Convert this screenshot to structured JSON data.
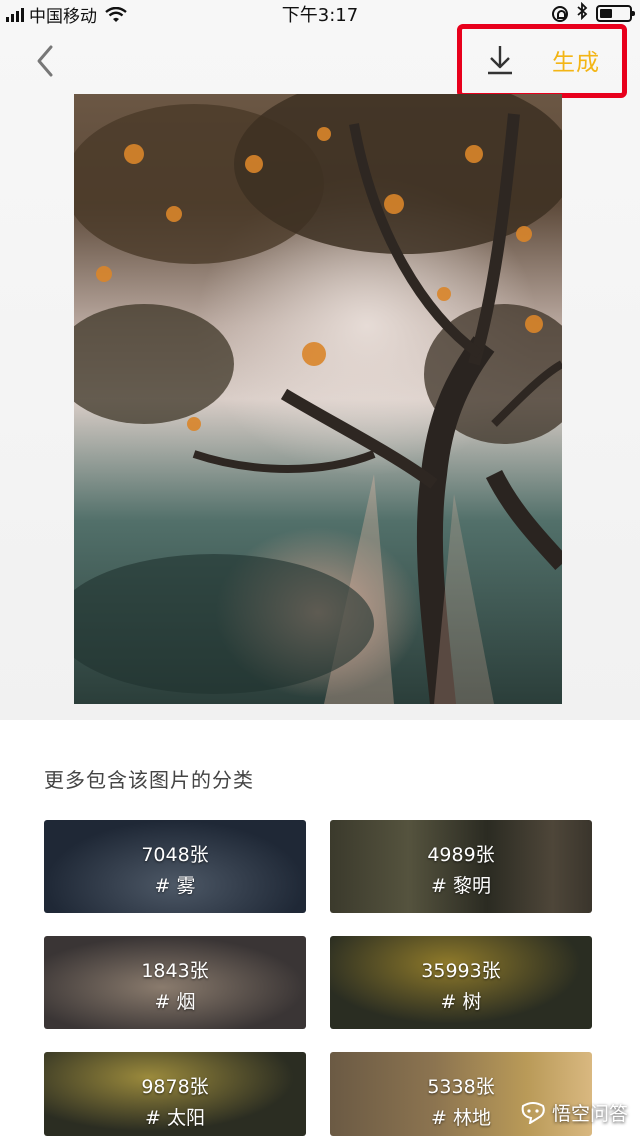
{
  "status_bar": {
    "carrier": "中国移动",
    "time": "下午3:17"
  },
  "header": {
    "back_icon": "chevron-left-icon",
    "download_icon": "download-icon",
    "generate_label": "生成",
    "accent_color": "#f3b515",
    "highlight_color": "#e8001c"
  },
  "section": {
    "title": "更多包含该图片的分类"
  },
  "categories": [
    {
      "count": "7048张",
      "tag": "# 雾"
    },
    {
      "count": "4989张",
      "tag": "# 黎明"
    },
    {
      "count": "1843张",
      "tag": "# 烟"
    },
    {
      "count": "35993张",
      "tag": "# 树"
    },
    {
      "count": "9878张",
      "tag": "# 太阳"
    },
    {
      "count": "5338张",
      "tag": "# 林地"
    }
  ],
  "watermark": {
    "text": "悟空问答"
  }
}
